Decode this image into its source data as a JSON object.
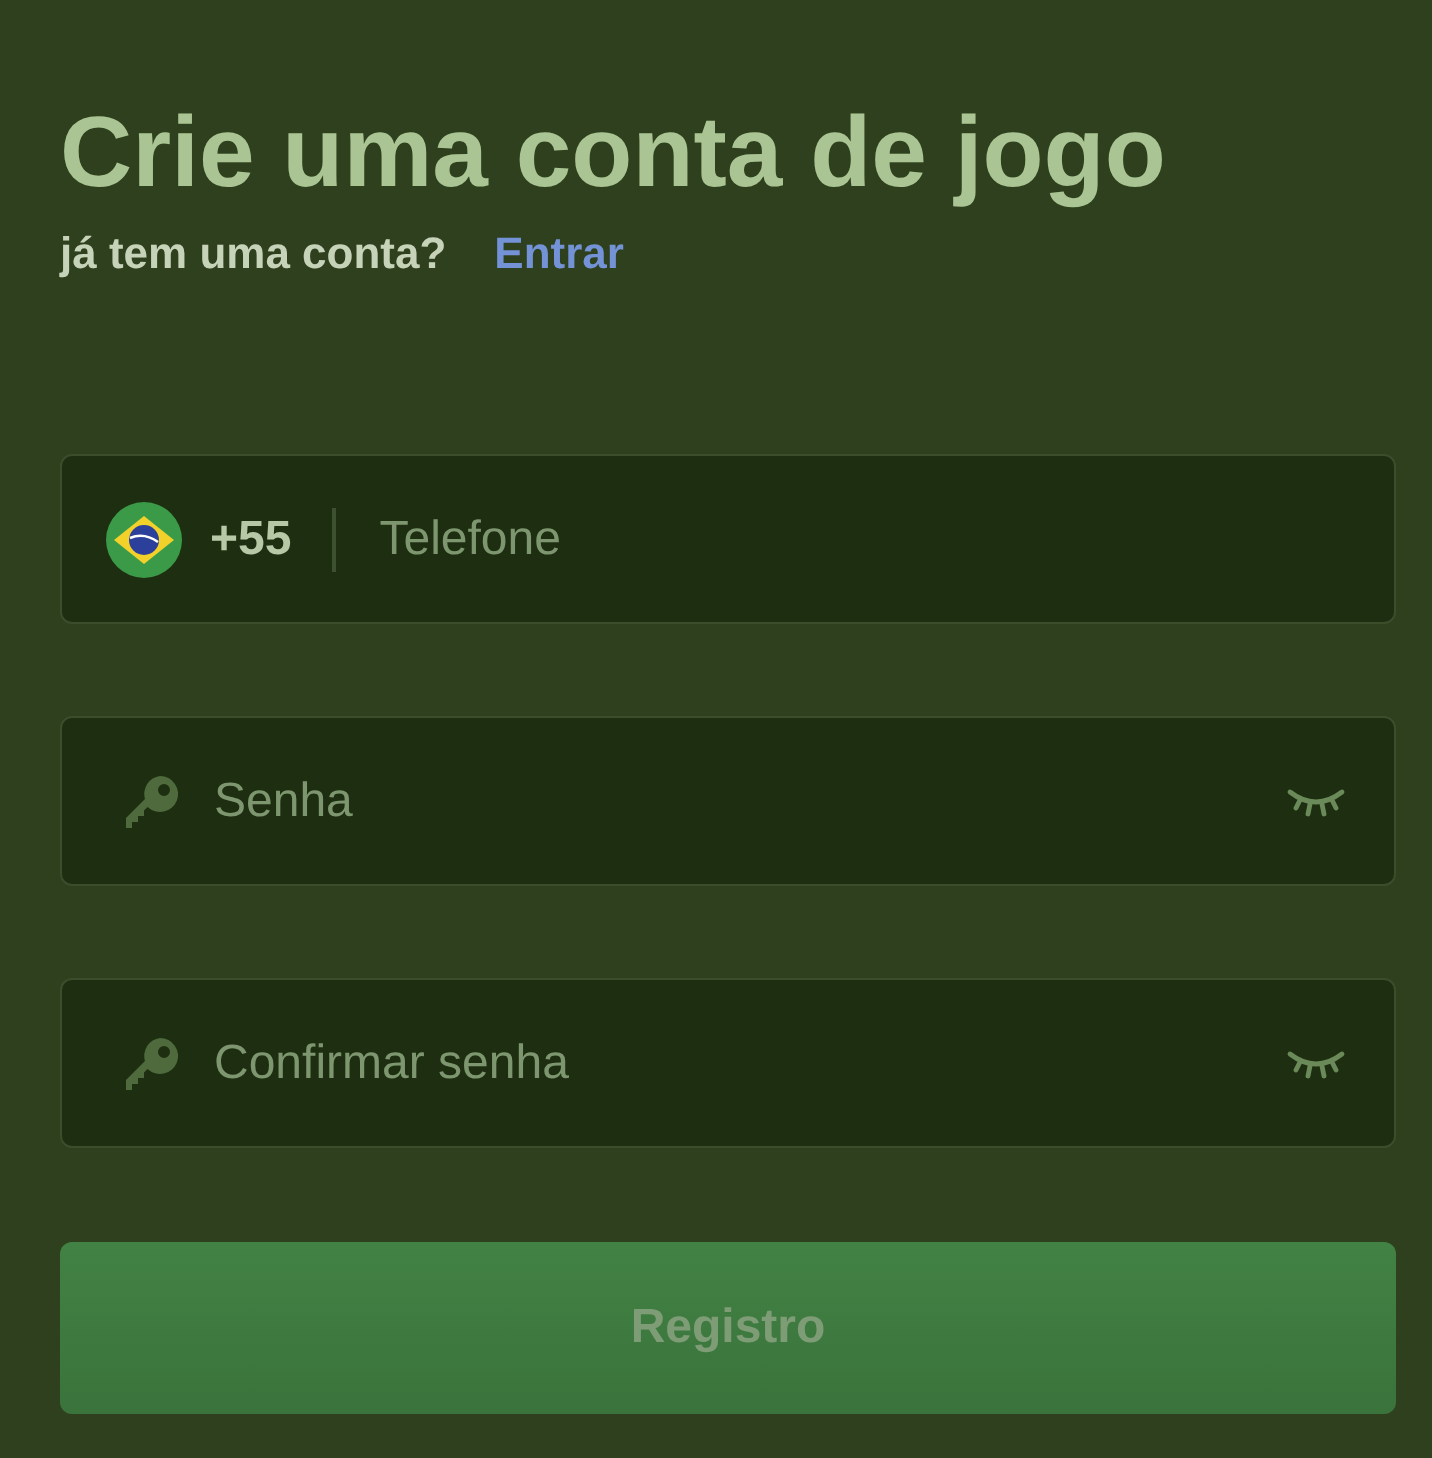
{
  "title": "Crie uma conta de jogo",
  "login_prompt": {
    "text": "já tem uma conta?",
    "link": "Entrar"
  },
  "fields": [
    {
      "kind": "phone",
      "country_code": "+55",
      "placeholder": "Telefone"
    },
    {
      "kind": "password",
      "placeholder": "Senha"
    },
    {
      "kind": "password",
      "placeholder": "Confirmar senha"
    }
  ],
  "submit_button": {
    "label": "Registro",
    "disabled": true
  }
}
